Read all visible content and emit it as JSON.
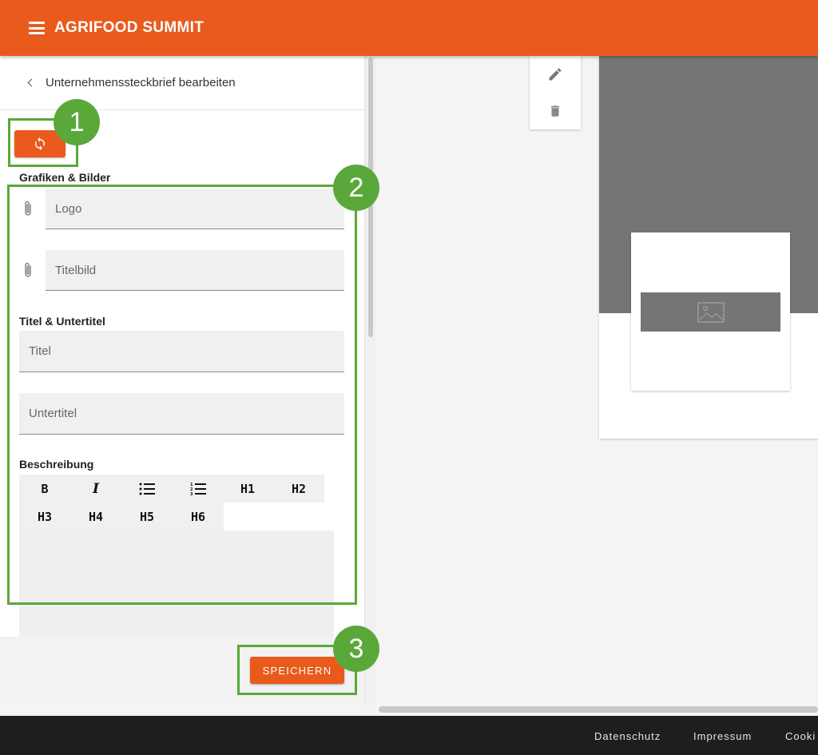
{
  "header": {
    "title": "AGRIFOOD SUMMIT"
  },
  "panel": {
    "back_label": "Unternehmenssteckbrief bearbeiten",
    "sections": {
      "graphics": "Grafiken & Bilder",
      "titles": "Titel & Untertitel",
      "description": "Beschreibung"
    },
    "fields": {
      "logo_placeholder": "Logo",
      "titlebild_placeholder": "Titelbild",
      "title_placeholder": "Titel",
      "subtitle_placeholder": "Untertitel"
    },
    "toolbar": [
      "B",
      "I",
      "ul",
      "ol",
      "H1",
      "H2",
      "H3",
      "H4",
      "H5",
      "H6"
    ],
    "save_label": "SPEICHERN"
  },
  "annotations": [
    "1",
    "2",
    "3"
  ],
  "footer": {
    "links": [
      "Datenschutz",
      "Impressum",
      "Cooki"
    ]
  },
  "icons": {
    "menu": "menu-icon",
    "back": "chevron-left-icon",
    "refresh": "refresh-icon",
    "attach": "paperclip-icon",
    "edit": "pencil-icon",
    "delete": "trash-icon",
    "image": "image-placeholder-icon"
  },
  "colors": {
    "brand": "#ea5a1c",
    "annotation": "#5aa83a",
    "footer": "#1e1e1e"
  }
}
